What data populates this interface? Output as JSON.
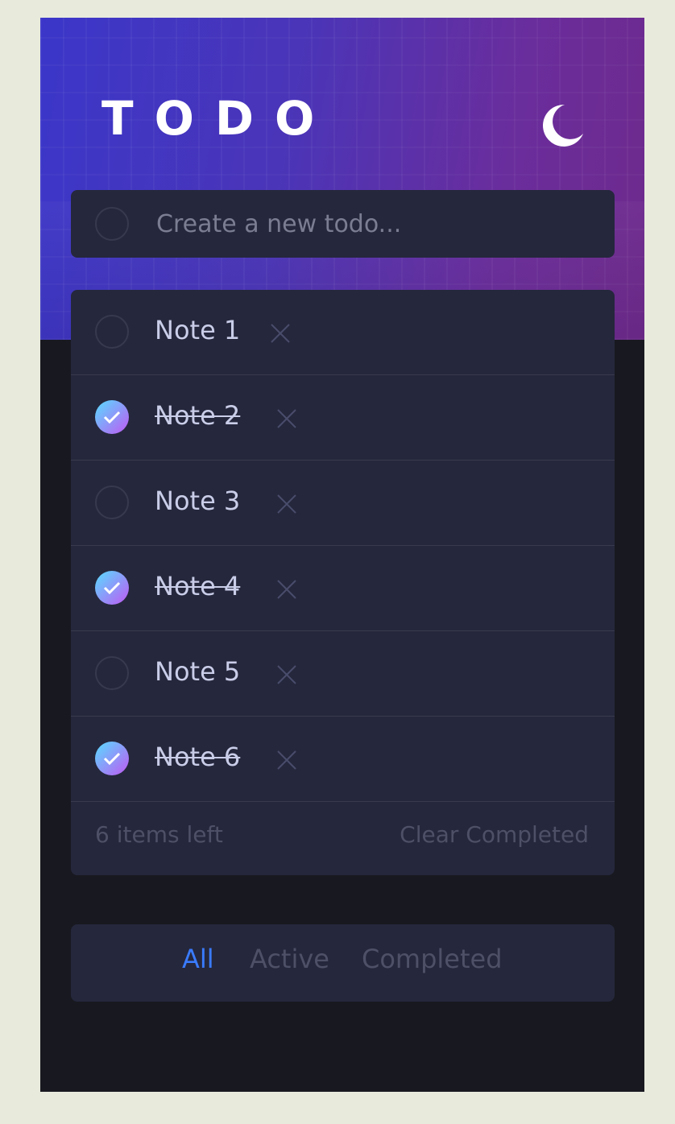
{
  "header": {
    "title": "TODO",
    "theme_icon": "moon-icon"
  },
  "new_todo": {
    "placeholder": "Create a new todo..."
  },
  "todos": [
    {
      "label": "Note 1",
      "completed": false
    },
    {
      "label": "Note 2",
      "completed": true
    },
    {
      "label": "Note 3",
      "completed": false
    },
    {
      "label": "Note 4",
      "completed": true
    },
    {
      "label": "Note 5",
      "completed": false
    },
    {
      "label": "Note 6",
      "completed": true
    }
  ],
  "footer": {
    "items_left": "6 items left",
    "clear_completed": "Clear Completed"
  },
  "filters": {
    "all": "All",
    "active": "Active",
    "completed": "Completed",
    "selected": "All"
  },
  "colors": {
    "card": "#25273c",
    "background": "#181820",
    "accent": "#3a7bfd",
    "check_gradient_start": "#57ddff",
    "check_gradient_end": "#c058f3"
  }
}
